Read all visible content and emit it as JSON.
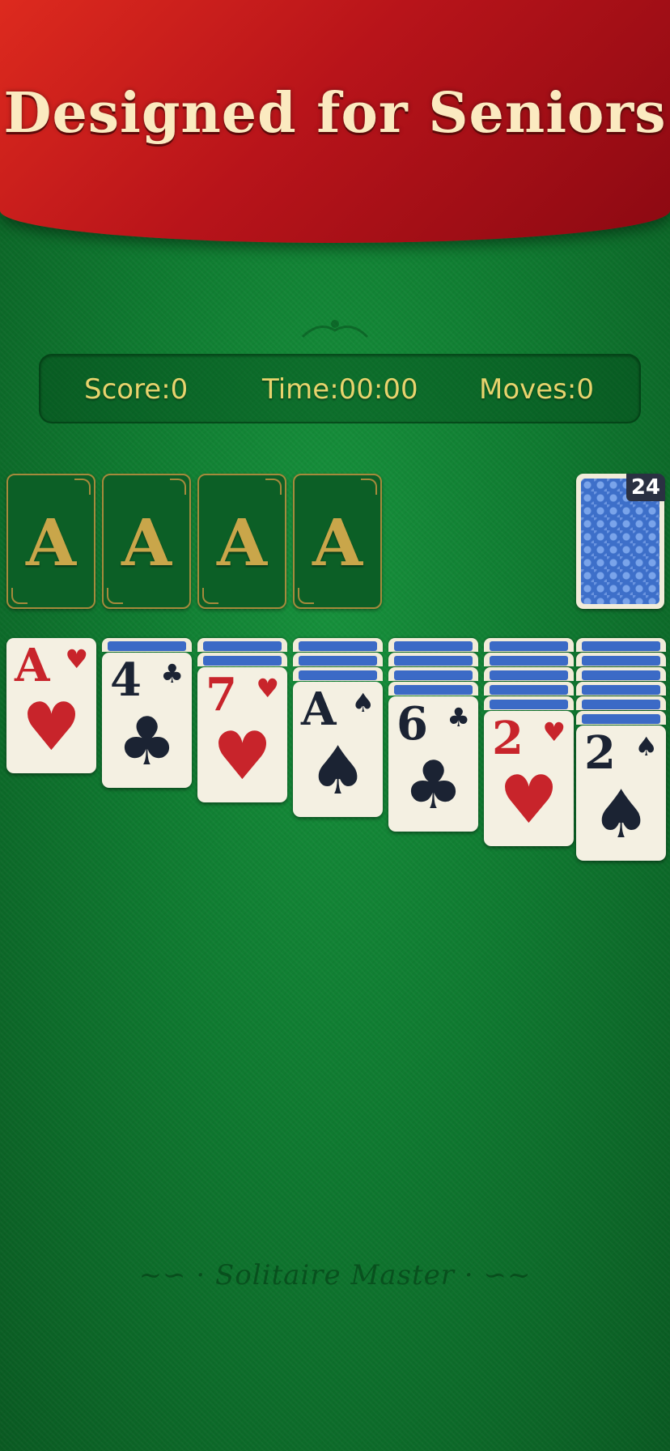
{
  "banner": {
    "title": "Designed for Seniors"
  },
  "colors": {
    "felt": "#0f7a30",
    "banner": "#b8141a",
    "gold": "#c9a64a",
    "hud_text": "#e7d36d",
    "card_back": "#3d6fc9",
    "red_suit": "#c8242b",
    "black_suit": "#1b2333"
  },
  "hud": {
    "score": "Score:0",
    "time": "Time:00:00",
    "moves": "Moves:0"
  },
  "foundations": [
    {
      "label": "A"
    },
    {
      "label": "A"
    },
    {
      "label": "A"
    },
    {
      "label": "A"
    }
  ],
  "stock": {
    "count": "24"
  },
  "tableau": [
    {
      "face_down": 0,
      "rank": "A",
      "suit": "♥",
      "color": "red"
    },
    {
      "face_down": 1,
      "rank": "4",
      "suit": "♣",
      "color": "black"
    },
    {
      "face_down": 2,
      "rank": "7",
      "suit": "♥",
      "color": "red"
    },
    {
      "face_down": 3,
      "rank": "A",
      "suit": "♠",
      "color": "black"
    },
    {
      "face_down": 4,
      "rank": "6",
      "suit": "♣",
      "color": "black"
    },
    {
      "face_down": 5,
      "rank": "2",
      "suit": "♥",
      "color": "red"
    },
    {
      "face_down": 6,
      "rank": "2",
      "suit": "♠",
      "color": "black"
    }
  ],
  "footer": {
    "logo": "Solitaire Master"
  }
}
